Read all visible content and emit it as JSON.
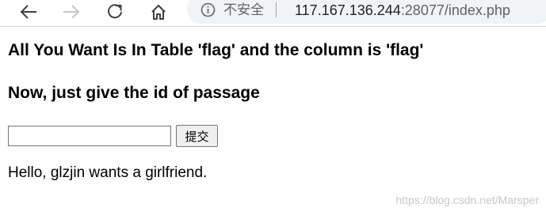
{
  "browser": {
    "security_label": "不安全",
    "url_host": "117.167.136.244",
    "url_rest": ":28077/index.php"
  },
  "page": {
    "heading_1": "All You Want Is In Table 'flag' and the column is 'flag'",
    "heading_2": "Now, just give the id of passage",
    "id_input": {
      "value": "",
      "placeholder": ""
    },
    "submit_label": "提交",
    "message": "Hello, glzjin wants a girlfriend."
  },
  "watermark": "https://blog.csdn.net/Marsper",
  "colors": {
    "toolbar_bg": "#ffffff",
    "address_bar_bg": "#f1f3f4",
    "url_host": "#202124",
    "url_rest": "#5f6368",
    "icon": "#5f6368",
    "icon_disabled": "#c7c7c7",
    "watermark": "#c8c8c8"
  },
  "icons": {
    "back": "back-arrow-icon",
    "forward": "forward-arrow-icon",
    "reload": "reload-icon",
    "home": "home-icon",
    "info": "info-icon"
  }
}
